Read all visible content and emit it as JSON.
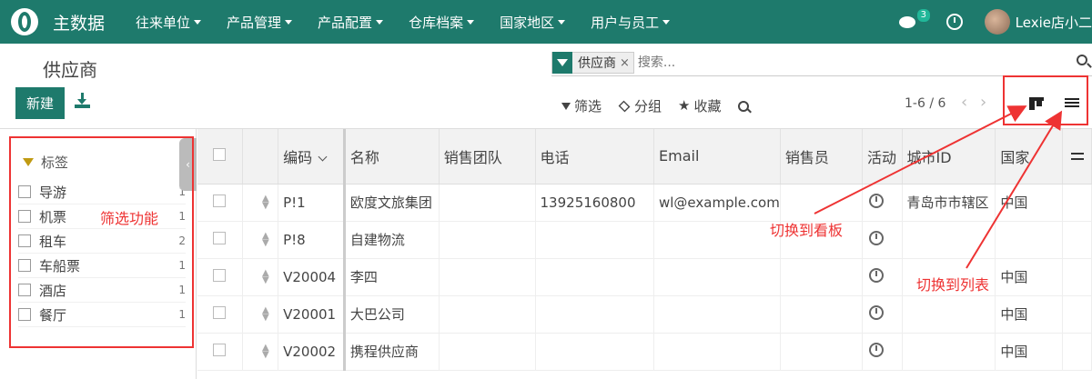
{
  "topbar": {
    "app_name": "主数据",
    "menu": [
      {
        "label": "往来单位"
      },
      {
        "label": "产品管理"
      },
      {
        "label": "产品配置"
      },
      {
        "label": "仓库档案"
      },
      {
        "label": "国家地区"
      },
      {
        "label": "用户与员工"
      }
    ],
    "chat_badge": "3",
    "user_name": "Lexie店小二",
    "icons": [
      "app-logo",
      "chat-icon",
      "clock-icon",
      "avatar"
    ]
  },
  "control": {
    "page_title": "供应商",
    "facet_label": "供应商",
    "facet_remove": "×",
    "search_placeholder": "搜索...",
    "new_label": "新建",
    "filter_label": "筛选",
    "group_label": "分组",
    "favorite_label": "收藏",
    "pager": "1-6 / 6",
    "prev": "‹",
    "next": "›"
  },
  "sidepanel": {
    "header": "标签",
    "collapse": "‹",
    "items": [
      {
        "label": "导游",
        "count": "1"
      },
      {
        "label": "机票",
        "count": "1"
      },
      {
        "label": "租车",
        "count": "2"
      },
      {
        "label": "车船票",
        "count": "1"
      },
      {
        "label": "酒店",
        "count": "1"
      },
      {
        "label": "餐厅",
        "count": "1"
      }
    ]
  },
  "table": {
    "columns": [
      "编码",
      "名称",
      "销售团队",
      "电话",
      "Email",
      "销售员",
      "活动",
      "城市ID",
      "国家"
    ],
    "rows": [
      {
        "code": "P!1",
        "name": "欧度文旅集团",
        "team": "",
        "phone": "13925160800",
        "email": "wl@example.com",
        "salesperson": "",
        "city": "青岛市市辖区",
        "country": "中国"
      },
      {
        "code": "P!8",
        "name": "自建物流",
        "team": "",
        "phone": "",
        "email": "",
        "salesperson": "",
        "city": "",
        "country": ""
      },
      {
        "code": "V20004",
        "name": "李四",
        "team": "",
        "phone": "",
        "email": "",
        "salesperson": "",
        "city": "",
        "country": "中国"
      },
      {
        "code": "V20001",
        "name": "大巴公司",
        "team": "",
        "phone": "",
        "email": "",
        "salesperson": "",
        "city": "",
        "country": "中国"
      },
      {
        "code": "V20002",
        "name": "携程供应商",
        "team": "",
        "phone": "",
        "email": "",
        "salesperson": "",
        "city": "",
        "country": "中国"
      }
    ]
  },
  "annotations": {
    "filter_note": "筛选功能",
    "kanban_note": "切换到看板",
    "list_note": "切换到列表",
    "color": "#ee3333"
  },
  "colors": {
    "brand": "#1e7a6c",
    "tag_funnel": "#c09a12"
  }
}
